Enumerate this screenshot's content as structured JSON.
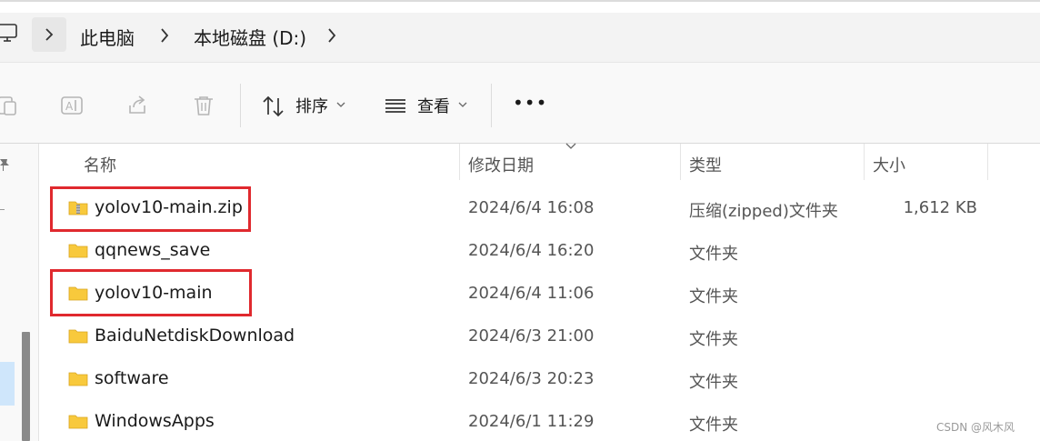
{
  "address_bar": {
    "crumbs": [
      "此电脑",
      "本地磁盘 (D:)"
    ]
  },
  "toolbar": {
    "sort_label": "排序",
    "view_label": "查看",
    "more_label": "•••"
  },
  "columns": {
    "name": "名称",
    "date": "修改日期",
    "type": "类型",
    "size": "大小"
  },
  "files": [
    {
      "name": "yolov10-main.zip",
      "date": "2024/6/4 16:08",
      "type": "压缩(zipped)文件夹",
      "size": "1,612 KB",
      "icon": "zip-folder-icon",
      "highlighted": true
    },
    {
      "name": "qqnews_save",
      "date": "2024/6/4 16:20",
      "type": "文件夹",
      "size": "",
      "icon": "folder-icon",
      "highlighted": false
    },
    {
      "name": "yolov10-main",
      "date": "2024/6/4 11:06",
      "type": "文件夹",
      "size": "",
      "icon": "folder-icon",
      "highlighted": true
    },
    {
      "name": "BaiduNetdiskDownload",
      "date": "2024/6/3 21:00",
      "type": "文件夹",
      "size": "",
      "icon": "folder-icon",
      "highlighted": false
    },
    {
      "name": "software",
      "date": "2024/6/3 20:23",
      "type": "文件夹",
      "size": "",
      "icon": "folder-icon",
      "highlighted": false
    },
    {
      "name": "WindowsApps",
      "date": "2024/6/1 11:29",
      "type": "文件夹",
      "size": "",
      "icon": "folder-icon",
      "highlighted": false
    }
  ],
  "watermark": "CSDN @风木风",
  "colors": {
    "highlight_border": "#e0292e",
    "folder_yellow": "#f8c93c"
  }
}
